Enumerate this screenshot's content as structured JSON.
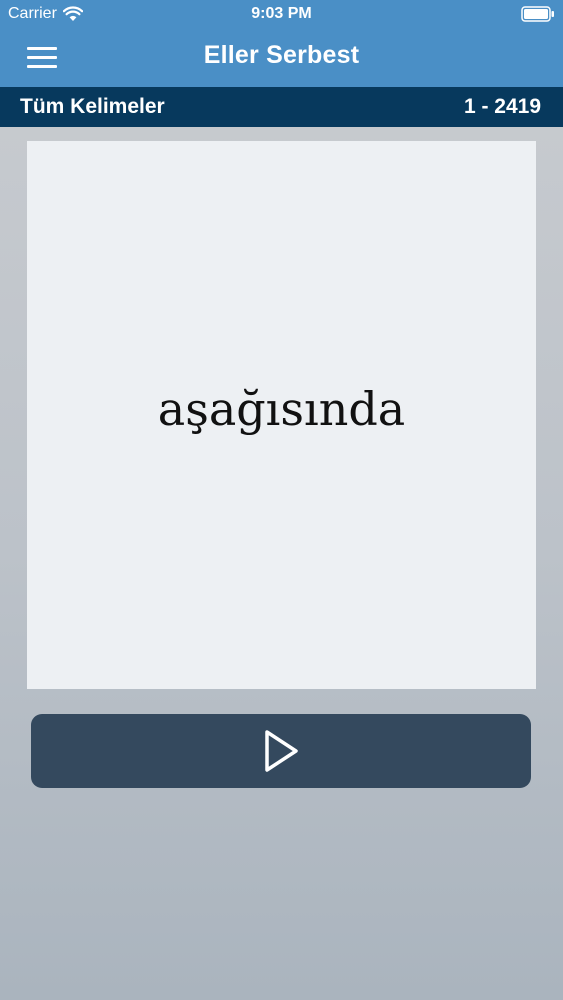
{
  "status_bar": {
    "carrier": "Carrier",
    "time": "9:03 PM"
  },
  "nav_bar": {
    "title": "Eller Serbest"
  },
  "category_bar": {
    "title": "Tüm Kelimeler",
    "range": "1 - 2419"
  },
  "card": {
    "word": "aşağısında"
  },
  "icons": {
    "menu": "hamburger-menu-icon",
    "play": "play-icon",
    "wifi": "wifi-icon",
    "battery": "battery-icon"
  },
  "colors": {
    "nav_blue": "#4a8fc6",
    "category_navy": "#07395d",
    "card_bg": "#edf0f3",
    "button_slate": "#34495e"
  }
}
